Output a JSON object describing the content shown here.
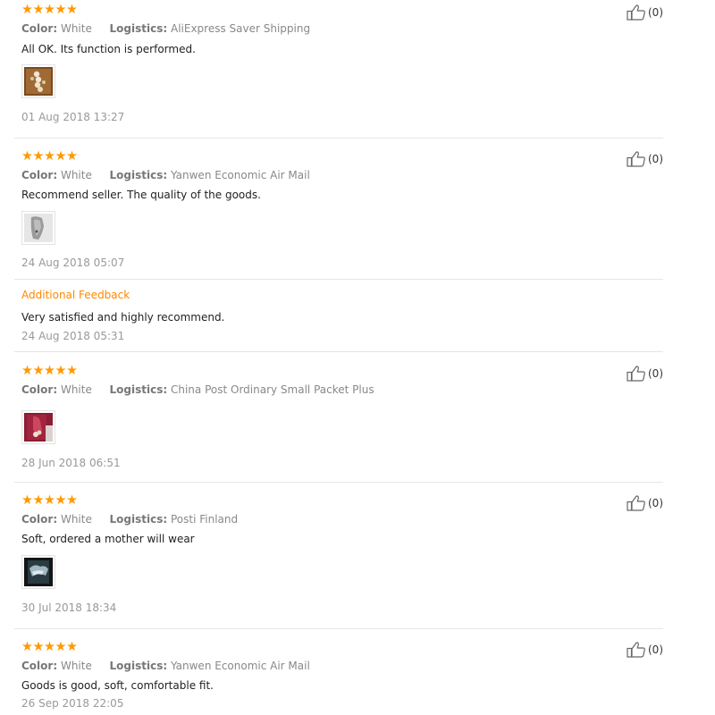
{
  "labels": {
    "color": "Color:",
    "logistics": "Logistics:",
    "additional_feedback": "Additional Feedback"
  },
  "stars_glyph": "★★★★★",
  "accent_color": "#ff9900",
  "reviews": [
    {
      "rating": 5,
      "color": "White",
      "logistics": "AliExpress Saver Shipping",
      "text": "All OK. Its function is performed.",
      "date": "01 Aug 2018 13:27",
      "likes": "(0)"
    },
    {
      "rating": 5,
      "color": "White",
      "logistics": "Yanwen Economic Air Mail",
      "text": "Recommend seller. The quality of the goods.",
      "date": "24 Aug 2018 05:07",
      "likes": "(0)",
      "additional_feedback": {
        "text": "Very satisfied and highly recommend.",
        "date": "24 Aug 2018 05:31"
      }
    },
    {
      "rating": 5,
      "color": "White",
      "logistics": "China Post Ordinary Small Packet Plus",
      "text": "",
      "date": "28 Jun 2018 06:51",
      "likes": "(0)"
    },
    {
      "rating": 5,
      "color": "White",
      "logistics": "Posti Finland",
      "text": "Soft, ordered a mother will wear",
      "date": "30 Jul 2018 18:34",
      "likes": "(0)"
    },
    {
      "rating": 5,
      "color": "White",
      "logistics": "Yanwen Economic Air Mail",
      "text": "Goods is good, soft, comfortable fit.",
      "date": "26 Sep 2018 22:05",
      "likes": "(0)"
    }
  ]
}
